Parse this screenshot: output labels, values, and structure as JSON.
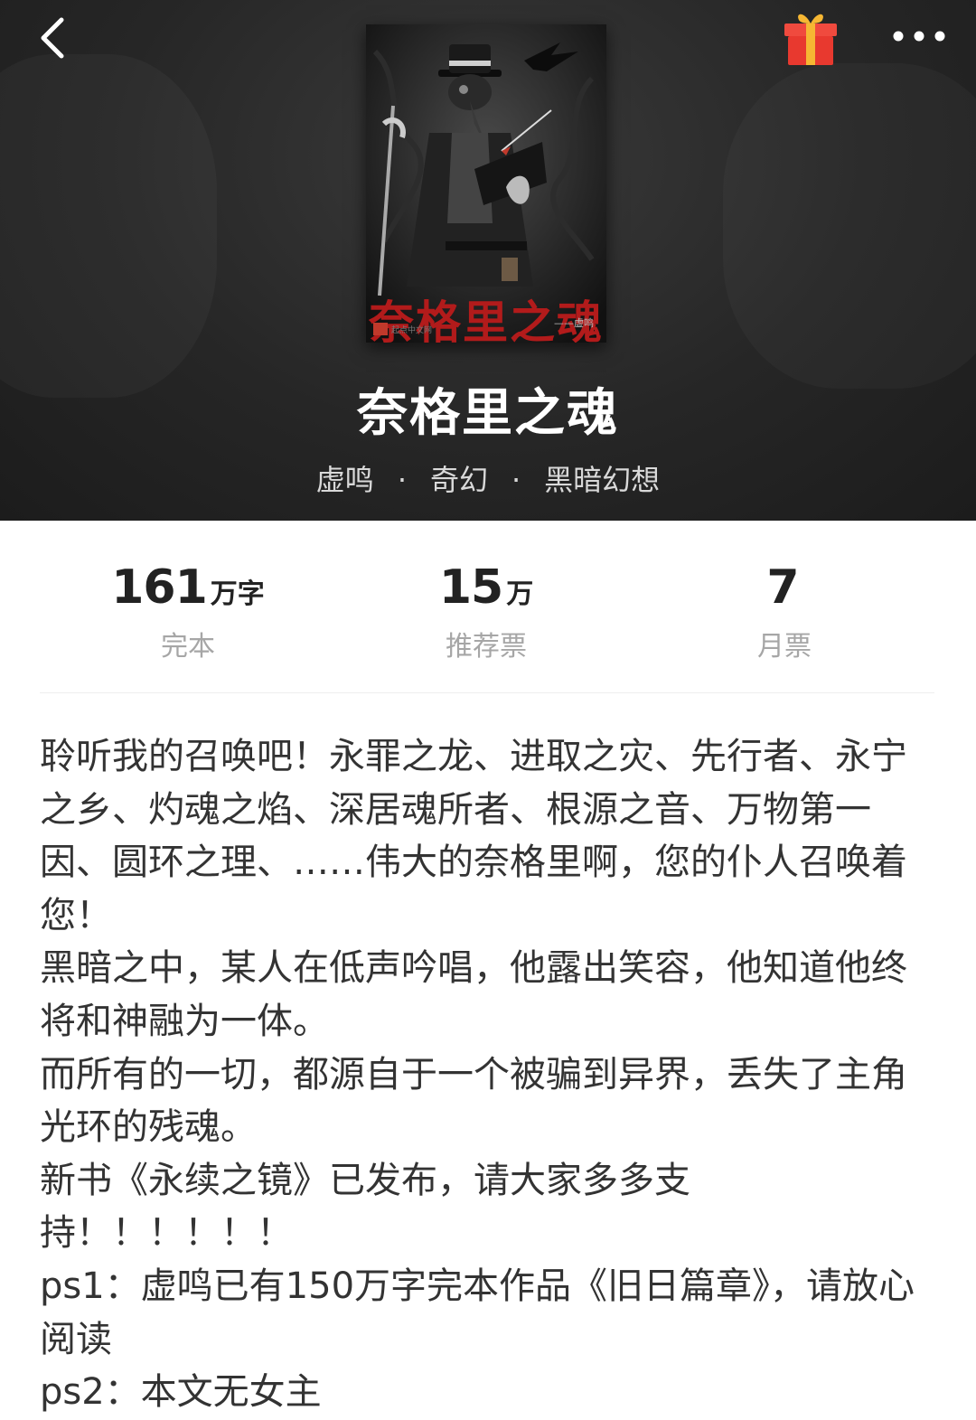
{
  "header": {
    "title": "奈格里之魂",
    "author": "虚鸣",
    "category": "奇幻",
    "subcategory": "黑暗幻想",
    "separator": "·",
    "cover": {
      "title_text": "奈格里之魂",
      "publisher_text": "起点中文网",
      "author_text": "——虚鸣",
      "title_color": "#b21b1b"
    },
    "icons": {
      "back": "chevron-left-icon",
      "gift": "gift-icon",
      "more": "more-dots-icon"
    }
  },
  "stats": [
    {
      "value": "161",
      "unit": "万字",
      "label": "完本"
    },
    {
      "value": "15",
      "unit": "万",
      "label": "推荐票"
    },
    {
      "value": "7",
      "unit": "",
      "label": "月票"
    }
  ],
  "description": [
    "聆听我的召唤吧！永罪之龙、进取之灾、先行者、永宁之乡、灼魂之焰、深居魂所者、根源之音、万物第一因、圆环之理、……伟大的奈格里啊，您的仆人召唤着您！",
    "黑暗之中，某人在低声吟唱，他露出笑容，他知道他终将和神融为一体。",
    "而所有的一切，都源自于一个被骗到异界，丢失了主角光环的残魂。",
    "新书《永续之镜》已发布，请大家多多支持！！！！！！",
    "ps1：虚鸣已有150万字完本作品《旧日篇章》，请放心阅读",
    "ps2：本文无女主"
  ]
}
